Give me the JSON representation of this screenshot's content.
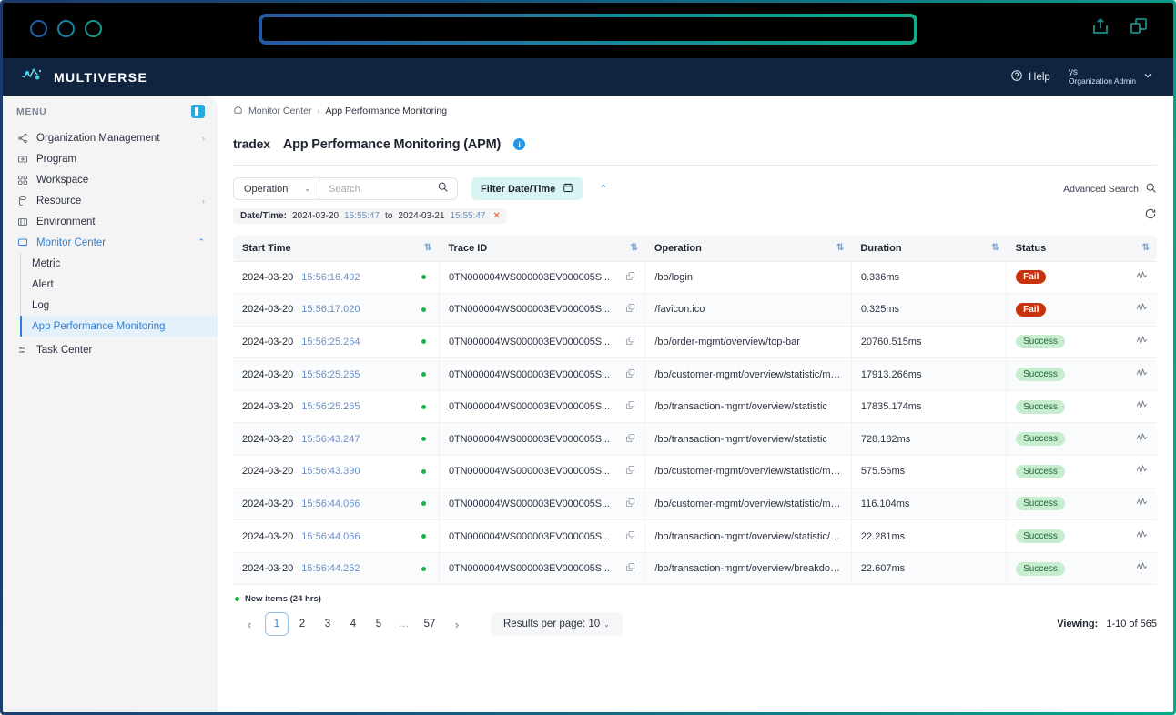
{
  "browser": {
    "traffic_lights": [
      "circle-1",
      "circle-2",
      "circle-3"
    ],
    "url_value": "",
    "share_icon": "share-upload-icon",
    "tabs_icon": "copy-windows-icon"
  },
  "appbar": {
    "brand": "MULTIVERSE",
    "help_label": "Help",
    "user_initials": "ys",
    "user_role": "Organization Admin",
    "chevron": "▾"
  },
  "sidebar": {
    "menu_label": "MENU",
    "toggle_icon": "panel-collapse-icon",
    "items": [
      {
        "label": "Organization Management",
        "icon": "share-nodes-icon",
        "chevron": "›"
      },
      {
        "label": "Program",
        "icon": "program-icon",
        "chevron": ""
      },
      {
        "label": "Workspace",
        "icon": "workspace-grid-icon",
        "chevron": ""
      },
      {
        "label": "Resource",
        "icon": "resource-icon",
        "chevron": "›"
      },
      {
        "label": "Environment",
        "icon": "environment-icon",
        "chevron": ""
      },
      {
        "label": "Monitor Center",
        "icon": "monitor-icon",
        "chevron": "⌃",
        "active": true
      }
    ],
    "sub_items": [
      {
        "label": "Metric"
      },
      {
        "label": "Alert"
      },
      {
        "label": "Log"
      },
      {
        "label": "App Performance Monitoring",
        "active": true
      }
    ],
    "bottom_items": [
      {
        "label": "Task Center",
        "icon": "task-center-icon",
        "chevron": ""
      }
    ]
  },
  "breadcrumb": {
    "home_icon": "home-icon",
    "first": "Monitor Center",
    "sep": "›",
    "last": "App Performance Monitoring"
  },
  "header": {
    "tenant": "tradex",
    "title": "App Performance Monitoring (APM)",
    "info_icon": "i"
  },
  "filters": {
    "dropdown_value": "Operation",
    "dropdown_caret": "⌄",
    "search_placeholder": "Search",
    "search_value": "",
    "search_icon": "search-icon",
    "filter_datetime_label": "Filter Date/Time",
    "calendar_icon": "calendar-icon",
    "collapse_caret": "⌃",
    "advanced_search_label": "Advanced Search",
    "refresh_icon": "refresh-icon",
    "chip": {
      "key": "Date/Time:",
      "from_date": "2024-03-20",
      "from_time": "15:55:47",
      "joiner": "to",
      "to_date": "2024-03-21",
      "to_time": "15:55:47",
      "remove": "✕"
    }
  },
  "table": {
    "columns": [
      {
        "label": "Start Time",
        "sortable": true
      },
      {
        "label": "Trace ID",
        "sortable": true
      },
      {
        "label": "Operation",
        "sortable": true
      },
      {
        "label": "Duration",
        "sortable": true
      },
      {
        "label": "Status",
        "sortable": true
      }
    ],
    "sort_icon": "sort-updown-icon",
    "copy_icon": "copy-icon",
    "pulse_icon": "activity-pulse-icon",
    "rows": [
      {
        "date": "2024-03-20",
        "time": "15:56:16.492",
        "trace": "0TN000004WS000003EV000005S...",
        "operation": "/bo/login",
        "duration": "0.336ms",
        "status": "Fail",
        "status_type": "fail"
      },
      {
        "date": "2024-03-20",
        "time": "15:56:17.020",
        "trace": "0TN000004WS000003EV000005S...",
        "operation": "/favicon.ico",
        "duration": "0.325ms",
        "status": "Fail",
        "status_type": "fail"
      },
      {
        "date": "2024-03-20",
        "time": "15:56:25.264",
        "trace": "0TN000004WS000003EV000005S...",
        "operation": "/bo/order-mgmt/overview/top-bar",
        "duration": "20760.515ms",
        "status": "Success",
        "status_type": "success"
      },
      {
        "date": "2024-03-20",
        "time": "15:56:25.265",
        "trace": "0TN000004WS000003EV000005S...",
        "operation": "/bo/customer-mgmt/overview/statistic/mock",
        "duration": "17913.266ms",
        "status": "Success",
        "status_type": "success"
      },
      {
        "date": "2024-03-20",
        "time": "15:56:25.265",
        "trace": "0TN000004WS000003EV000005S...",
        "operation": "/bo/transaction-mgmt/overview/statistic",
        "duration": "17835.174ms",
        "status": "Success",
        "status_type": "success"
      },
      {
        "date": "2024-03-20",
        "time": "15:56:43.247",
        "trace": "0TN000004WS000003EV000005S...",
        "operation": "/bo/transaction-mgmt/overview/statistic",
        "duration": "728.182ms",
        "status": "Success",
        "status_type": "success"
      },
      {
        "date": "2024-03-20",
        "time": "15:56:43.390",
        "trace": "0TN000004WS000003EV000005S...",
        "operation": "/bo/customer-mgmt/overview/statistic/mock",
        "duration": "575.56ms",
        "status": "Success",
        "status_type": "success"
      },
      {
        "date": "2024-03-20",
        "time": "15:56:44.066",
        "trace": "0TN000004WS000003EV000005S...",
        "operation": "/bo/customer-mgmt/overview/statistic/mock",
        "duration": "116.104ms",
        "status": "Success",
        "status_type": "success"
      },
      {
        "date": "2024-03-20",
        "time": "15:56:44.066",
        "trace": "0TN000004WS000003EV000005S...",
        "operation": "/bo/transaction-mgmt/overview/statistic/li...",
        "duration": "22.281ms",
        "status": "Success",
        "status_type": "success"
      },
      {
        "date": "2024-03-20",
        "time": "15:56:44.252",
        "trace": "0TN000004WS000003EV000005S...",
        "operation": "/bo/transaction-mgmt/overview/breakdown",
        "duration": "22.607ms",
        "status": "Success",
        "status_type": "success"
      }
    ]
  },
  "footer": {
    "legend_label": "New items (24 hrs)",
    "prev": "‹",
    "next": "›",
    "pages": [
      "1",
      "2",
      "3",
      "4",
      "5",
      "…",
      "57"
    ],
    "active_page": "1",
    "results_per_page_label": "Results per page: 10",
    "results_caret": "⌄",
    "viewing_label": "Viewing:",
    "viewing_value": "1-10 of 565"
  },
  "colors": {
    "accent_blue": "#2f7fd4",
    "fail_red": "#c8330f",
    "success_green": "#c8ecd0",
    "brand_navy": "#11243f",
    "teal": "#0aa88a"
  }
}
